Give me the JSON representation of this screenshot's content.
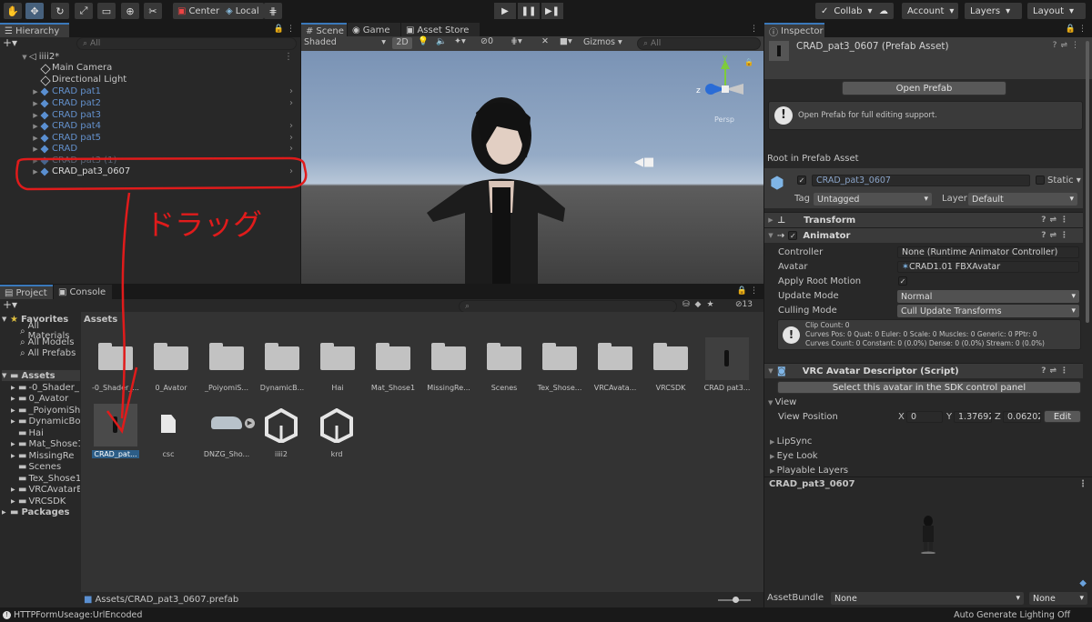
{
  "toolbar": {
    "pivot_label": "Center",
    "space_label": "Local",
    "collab_label": "Collab",
    "account_label": "Account",
    "layers_label": "Layers",
    "layout_label": "Layout"
  },
  "hierarchy": {
    "tab_label": "Hierarchy",
    "search_placeholder": "All",
    "scene_name": "iiii2*",
    "items": [
      {
        "label": "Main Camera"
      },
      {
        "label": "Directional Light"
      },
      {
        "label": "CRAD pat1"
      },
      {
        "label": "CRAD pat2"
      },
      {
        "label": "CRAD pat3"
      },
      {
        "label": "CRAD pat4"
      },
      {
        "label": "CRAD pat5"
      },
      {
        "label": "CRAD"
      },
      {
        "label": "CRAD pat3 (1)"
      },
      {
        "label": "CRAD_pat3_0607"
      }
    ]
  },
  "annotation": {
    "text": "ドラッグ",
    "color": "#e01b1b"
  },
  "scene": {
    "tabs": [
      "Scene",
      "Game",
      "Asset Store"
    ],
    "shading_mode": "Shaded",
    "mode_2d": "2D",
    "hidden_count": "0",
    "gizmos_label": "Gizmos",
    "search_placeholder": "All",
    "gizmo_axes": {
      "y": "y",
      "z": "z",
      "view": "Persp"
    }
  },
  "project": {
    "tabs": [
      "Project",
      "Console"
    ],
    "hidden_count": "13",
    "tree": [
      {
        "label": "Favorites"
      },
      {
        "label": "All Materials"
      },
      {
        "label": "All Models"
      },
      {
        "label": "All Prefabs"
      },
      {
        "label": "Assets"
      },
      {
        "label": "-0_Shader_"
      },
      {
        "label": "0_Avator"
      },
      {
        "label": "_PoiyomiSh"
      },
      {
        "label": "DynamicBo"
      },
      {
        "label": "Hai"
      },
      {
        "label": "Mat_Shose1"
      },
      {
        "label": "MissingRe"
      },
      {
        "label": "Scenes"
      },
      {
        "label": "Tex_Shose1"
      },
      {
        "label": "VRCAvatarE"
      },
      {
        "label": "VRCSDK"
      },
      {
        "label": "Packages"
      }
    ],
    "breadcrumb": "Assets",
    "grid_row1": [
      "-0_Shader_...",
      "0_Avator",
      "_PoiyomiS...",
      "DynamicB...",
      "Hai",
      "Mat_Shose1",
      "MissingRe...",
      "Scenes",
      "Tex_Shose...",
      "VRCAvata...",
      "VRCSDK",
      "CRAD pat3..."
    ],
    "grid_row2": [
      "CRAD_pat...",
      "csc",
      "DNZG_Sho...",
      "iiii2",
      "krd"
    ],
    "status_path": "Assets/CRAD_pat3_0607.prefab"
  },
  "inspector": {
    "tab_label": "Inspector",
    "asset_title": "CRAD_pat3_0607 (Prefab Asset)",
    "open_prefab": "Open Prefab",
    "help_text": "Open Prefab for full editing support.",
    "root_label": "Root in Prefab Asset",
    "object_name": "CRAD_pat3_0607",
    "static_label": "Static",
    "tag_label": "Tag",
    "tag_value": "Untagged",
    "layer_label": "Layer",
    "layer_value": "Default",
    "transform_label": "Transform",
    "animator": {
      "title": "Animator",
      "controller_label": "Controller",
      "controller_value": "None (Runtime Animator Controller)",
      "avatar_label": "Avatar",
      "avatar_value": "CRAD1.01 FBXAvatar",
      "root_motion_label": "Apply Root Motion",
      "update_mode_label": "Update Mode",
      "update_mode_value": "Normal",
      "culling_label": "Culling Mode",
      "culling_value": "Cull Update Transforms",
      "info_lines": [
        "Clip Count: 0",
        "Curves Pos: 0 Quat: 0 Euler: 0 Scale: 0 Muscles: 0 Generic: 0 PPtr: 0",
        "Curves Count: 0 Constant: 0 (0.0%) Dense: 0 (0.0%) Stream: 0 (0.0%)"
      ]
    },
    "vrc": {
      "title": "VRC Avatar Descriptor (Script)",
      "select_button": "Select this avatar in the SDK control panel",
      "view_label": "View",
      "view_position_label": "View Position",
      "x_label": "X",
      "x_value": "0",
      "y_label": "Y",
      "y_value": "1.37692",
      "z_label": "Z",
      "z_value": "0.06202",
      "edit_button": "Edit",
      "lipsync": "LipSync",
      "eyelook": "Eye Look",
      "playable": "Playable Layers"
    },
    "preview_title": "CRAD_pat3_0607",
    "assetbundle_label": "AssetBundle",
    "assetbundle_value": "None",
    "assetbundle_variant": "None"
  },
  "statusbar": {
    "left": "HTTPFormUseage:UrlEncoded",
    "right": "Auto Generate Lighting Off"
  }
}
